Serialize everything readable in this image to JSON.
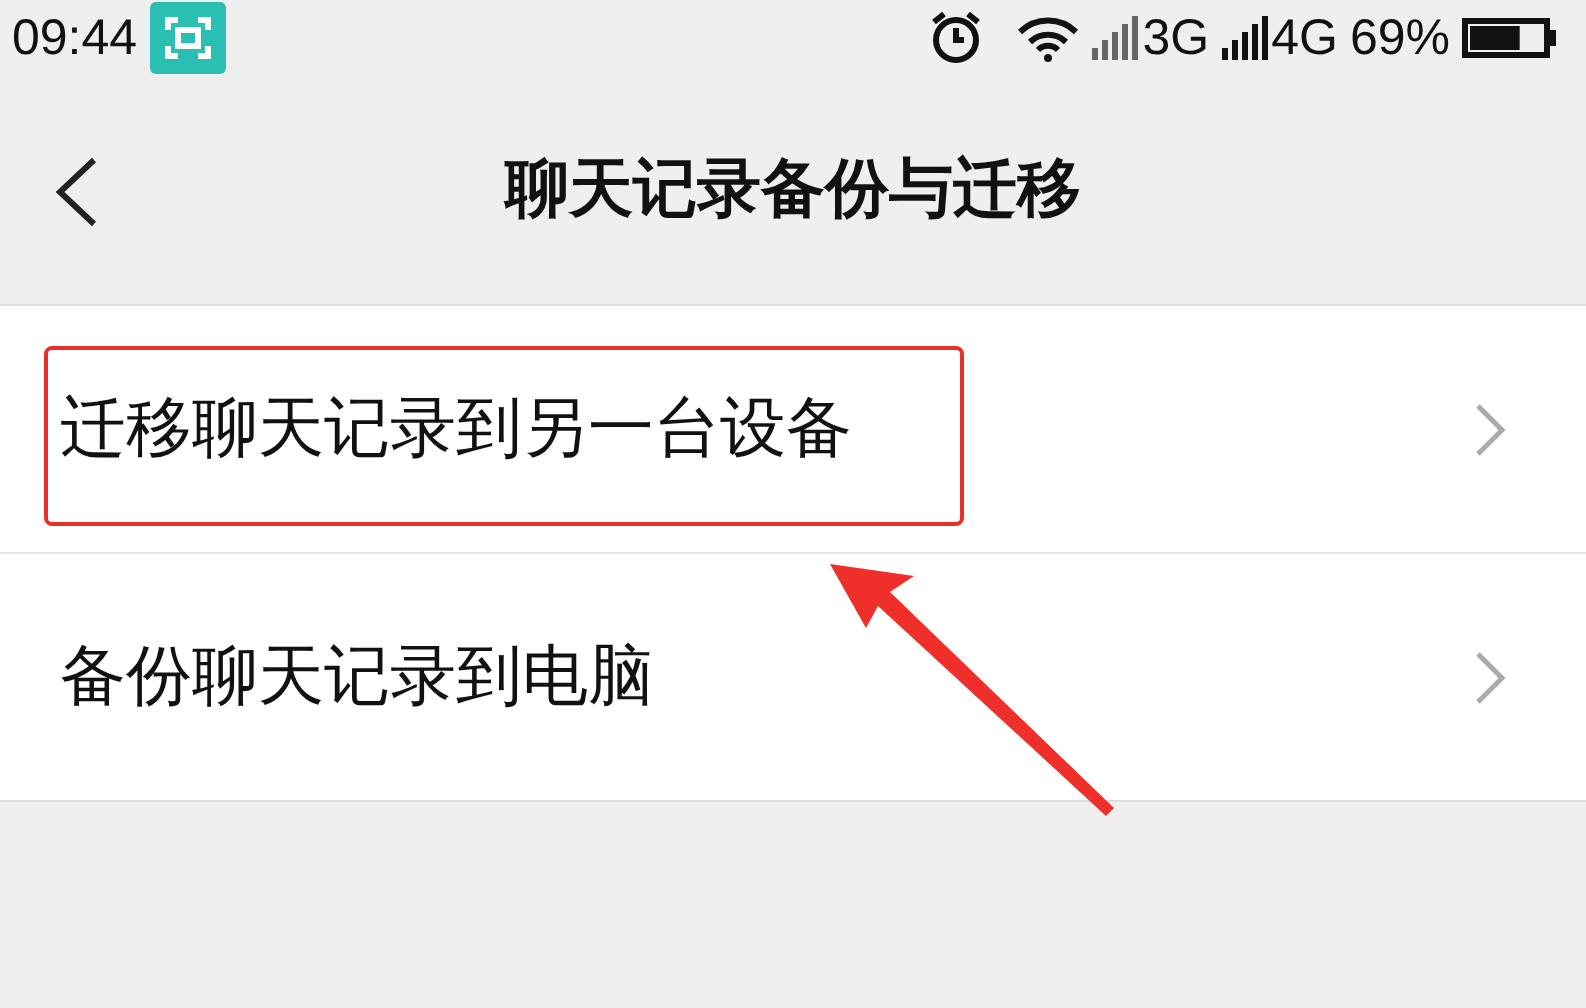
{
  "status_bar": {
    "time": "09:44",
    "network_1": "3G",
    "network_2": "4G",
    "battery": "69%"
  },
  "header": {
    "title": "聊天记录备份与迁移"
  },
  "items": [
    {
      "label": "迁移聊天记录到另一台设备",
      "highlighted": true
    },
    {
      "label": "备份聊天记录到电脑",
      "highlighted": false
    }
  ]
}
